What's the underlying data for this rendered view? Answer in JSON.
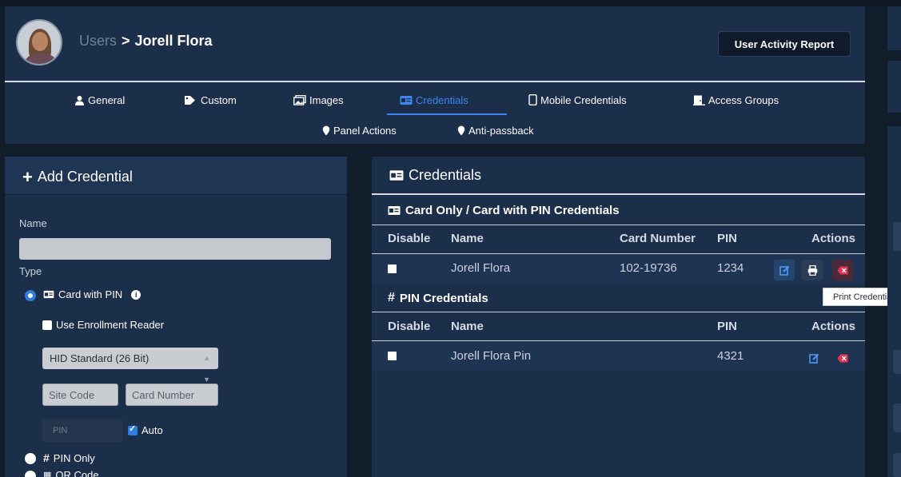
{
  "header": {
    "breadcrumb_parent": "Users",
    "breadcrumb_sep": ">",
    "breadcrumb_current": "Jorell Flora",
    "report_button": "User Activity Report"
  },
  "tabs": [
    {
      "label": "General",
      "icon": "user-icon",
      "active": false
    },
    {
      "label": "Custom",
      "icon": "tag-icon",
      "active": false
    },
    {
      "label": "Images",
      "icon": "images-icon",
      "active": false
    },
    {
      "label": "Credentials",
      "icon": "id-card-icon",
      "active": true
    },
    {
      "label": "Mobile Credentials",
      "icon": "mobile-icon",
      "active": false
    },
    {
      "label": "Access Groups",
      "icon": "door-icon",
      "active": false
    },
    {
      "label": "Panel Actions",
      "icon": "pin-icon",
      "active": false
    },
    {
      "label": "Anti-passback",
      "icon": "pin-icon",
      "active": false
    }
  ],
  "add_credential": {
    "title": "Add Credential",
    "name_label": "Name",
    "name_value": "",
    "type_label": "Type",
    "type_card_pin": "Card with PIN",
    "enrollment_label": "Use Enrollment Reader",
    "format_selected": "HID Standard (26 Bit)",
    "site_code_placeholder": "Site Code",
    "card_number_placeholder": "Card Number",
    "pin_placeholder": "PIN",
    "auto_label": "Auto",
    "pin_only": "PIN Only",
    "qr_code": "QR Code"
  },
  "credentials": {
    "title": "Credentials",
    "card_section_title": "Card Only / Card with PIN Credentials",
    "card_headers": {
      "disable": "Disable",
      "name": "Name",
      "card_number": "Card Number",
      "pin": "PIN",
      "actions": "Actions"
    },
    "card_rows": [
      {
        "name": "Jorell Flora",
        "card_number": "102-19736",
        "pin": "1234"
      }
    ],
    "pin_section_title": "PIN Credentials",
    "pin_headers": {
      "disable": "Disable",
      "name": "Name",
      "pin": "PIN",
      "actions": "Actions"
    },
    "pin_rows": [
      {
        "name": "Jorell Flora Pin",
        "pin": "4321"
      }
    ]
  },
  "tooltip": "Print Credential",
  "colors": {
    "accent": "#3b86f0",
    "panel": "#1b2e4a",
    "delete": "#e0364f"
  }
}
